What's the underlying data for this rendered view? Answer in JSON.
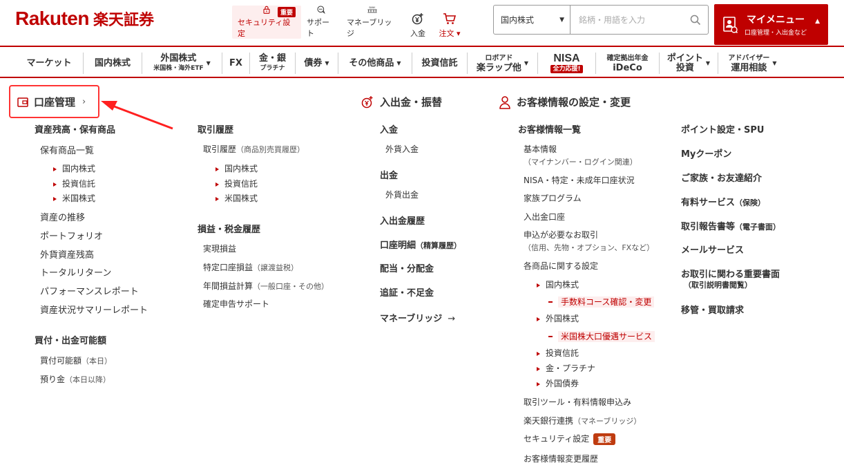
{
  "logo": {
    "en": "Rakuten",
    "jp": "楽天証券"
  },
  "topnav": {
    "security": "セキュリティ設定",
    "security_badge": "重要",
    "support": "サポート",
    "money_bridge": "マネーブリッジ",
    "deposit": "入金",
    "order": "注文 ▾",
    "bank_icon_label": "BANK"
  },
  "search": {
    "select_value": "国内株式",
    "placeholder": "銘柄・用語を入力"
  },
  "mymenu": {
    "title": "マイメニュー",
    "subtitle": "口座管理・入出金など"
  },
  "categories": [
    {
      "label": "マーケット"
    },
    {
      "label": "国内株式"
    },
    {
      "label": "外国株式",
      "sub": "米国株・海外ETF"
    },
    {
      "label": "FX"
    },
    {
      "label": "金・銀",
      "sub": "プラチナ"
    },
    {
      "label": "債券"
    },
    {
      "label": "その他商品"
    },
    {
      "label": "投資信託"
    },
    {
      "label": "ロボアド",
      "sub": "楽ラップ他"
    },
    {
      "label": "NISA",
      "badge": "全力応援!"
    },
    {
      "label": "確定拠出年金",
      "sub": "iDeCo"
    },
    {
      "label": "ポイント",
      "sub": "投資"
    },
    {
      "label": "アドバイザー",
      "sub": "運用相談"
    }
  ],
  "menu": {
    "account_title": "口座管理",
    "col1": {
      "h_assets": "資産残高・保有商品",
      "holdings": "保有商品一覧",
      "holdings_sub": [
        "国内株式",
        "投資信託",
        "米国株式"
      ],
      "links": [
        "資産の推移",
        "ポートフォリオ",
        "外貨資産残高",
        "トータルリターン",
        "パフォーマンスレポート",
        "資産状況サマリーレポート"
      ],
      "h_buying": "買付・出金可能額",
      "buying_links": [
        "買付可能額",
        "預り金"
      ],
      "buying_notes": [
        "（本日）",
        "（本日以降）"
      ]
    },
    "col2": {
      "h_history": "取引履歴",
      "history_link": "取引履歴",
      "history_note": "（商品別売買履歴）",
      "history_sub": [
        "国内株式",
        "投資信託",
        "米国株式"
      ],
      "h_pl": "損益・税金履歴",
      "pl_links": [
        "実現損益",
        "特定口座損益",
        "年間損益計算",
        "確定申告サポート"
      ],
      "pl_notes": [
        "（譲渡益税）",
        "（一般口座・その他）"
      ]
    },
    "col3": {
      "title": "入出金・振替",
      "h_deposit": "入金",
      "deposit_fx": "外貨入金",
      "h_withdraw": "出金",
      "withdraw_fx": "外貨出金",
      "h_history": "入出金履歴",
      "h_detail": "口座明細",
      "detail_note": "（精算履歴）",
      "h_dividend": "配当・分配金",
      "h_margin": "追証・不足金",
      "money_bridge": "マネーブリッジ"
    },
    "col4": {
      "title": "お客様情報の設定・変更",
      "h_list": "お客様情報一覧",
      "basic": "基本情報",
      "basic_note": "（マイナンバー・ログイン関連）",
      "nisa_status": "NISA・特定・未成年口座状況",
      "family": "家族プログラム",
      "deposit_account": "入出金口座",
      "apply_trade": "申込が必要なお取引",
      "apply_note": "（信用、先物・オプション、FXなど）",
      "product_settings": "各商品に関する設定",
      "ps_domestic": "国内株式",
      "ps_fee": "手数料コース確認・変更",
      "ps_foreign": "外国株式",
      "ps_us_large": "米国株大口優遇サービス",
      "ps_others": [
        "投資信託",
        "金・プラチナ",
        "外国債券"
      ],
      "tools": "取引ツール・有料情報申込み",
      "bank_link": "楽天銀行連携",
      "bank_note": "（マネーブリッジ）",
      "security": "セキュリティ設定",
      "security_badge": "重要",
      "change_history": "お客様情報変更履歴"
    },
    "col5": {
      "links": [
        "ポイント設定・SPU",
        "Myクーポン",
        "ご家族・お友達紹介"
      ],
      "paid": "有料サービス",
      "paid_note": "（保険）",
      "report": "取引報告書等",
      "report_note": "（電子書面）",
      "mail": "メールサービス",
      "important_docs": "お取引に関わる重要書面",
      "important_note": "（取引説明書閲覧）",
      "transfer": "移管・買取請求"
    }
  }
}
